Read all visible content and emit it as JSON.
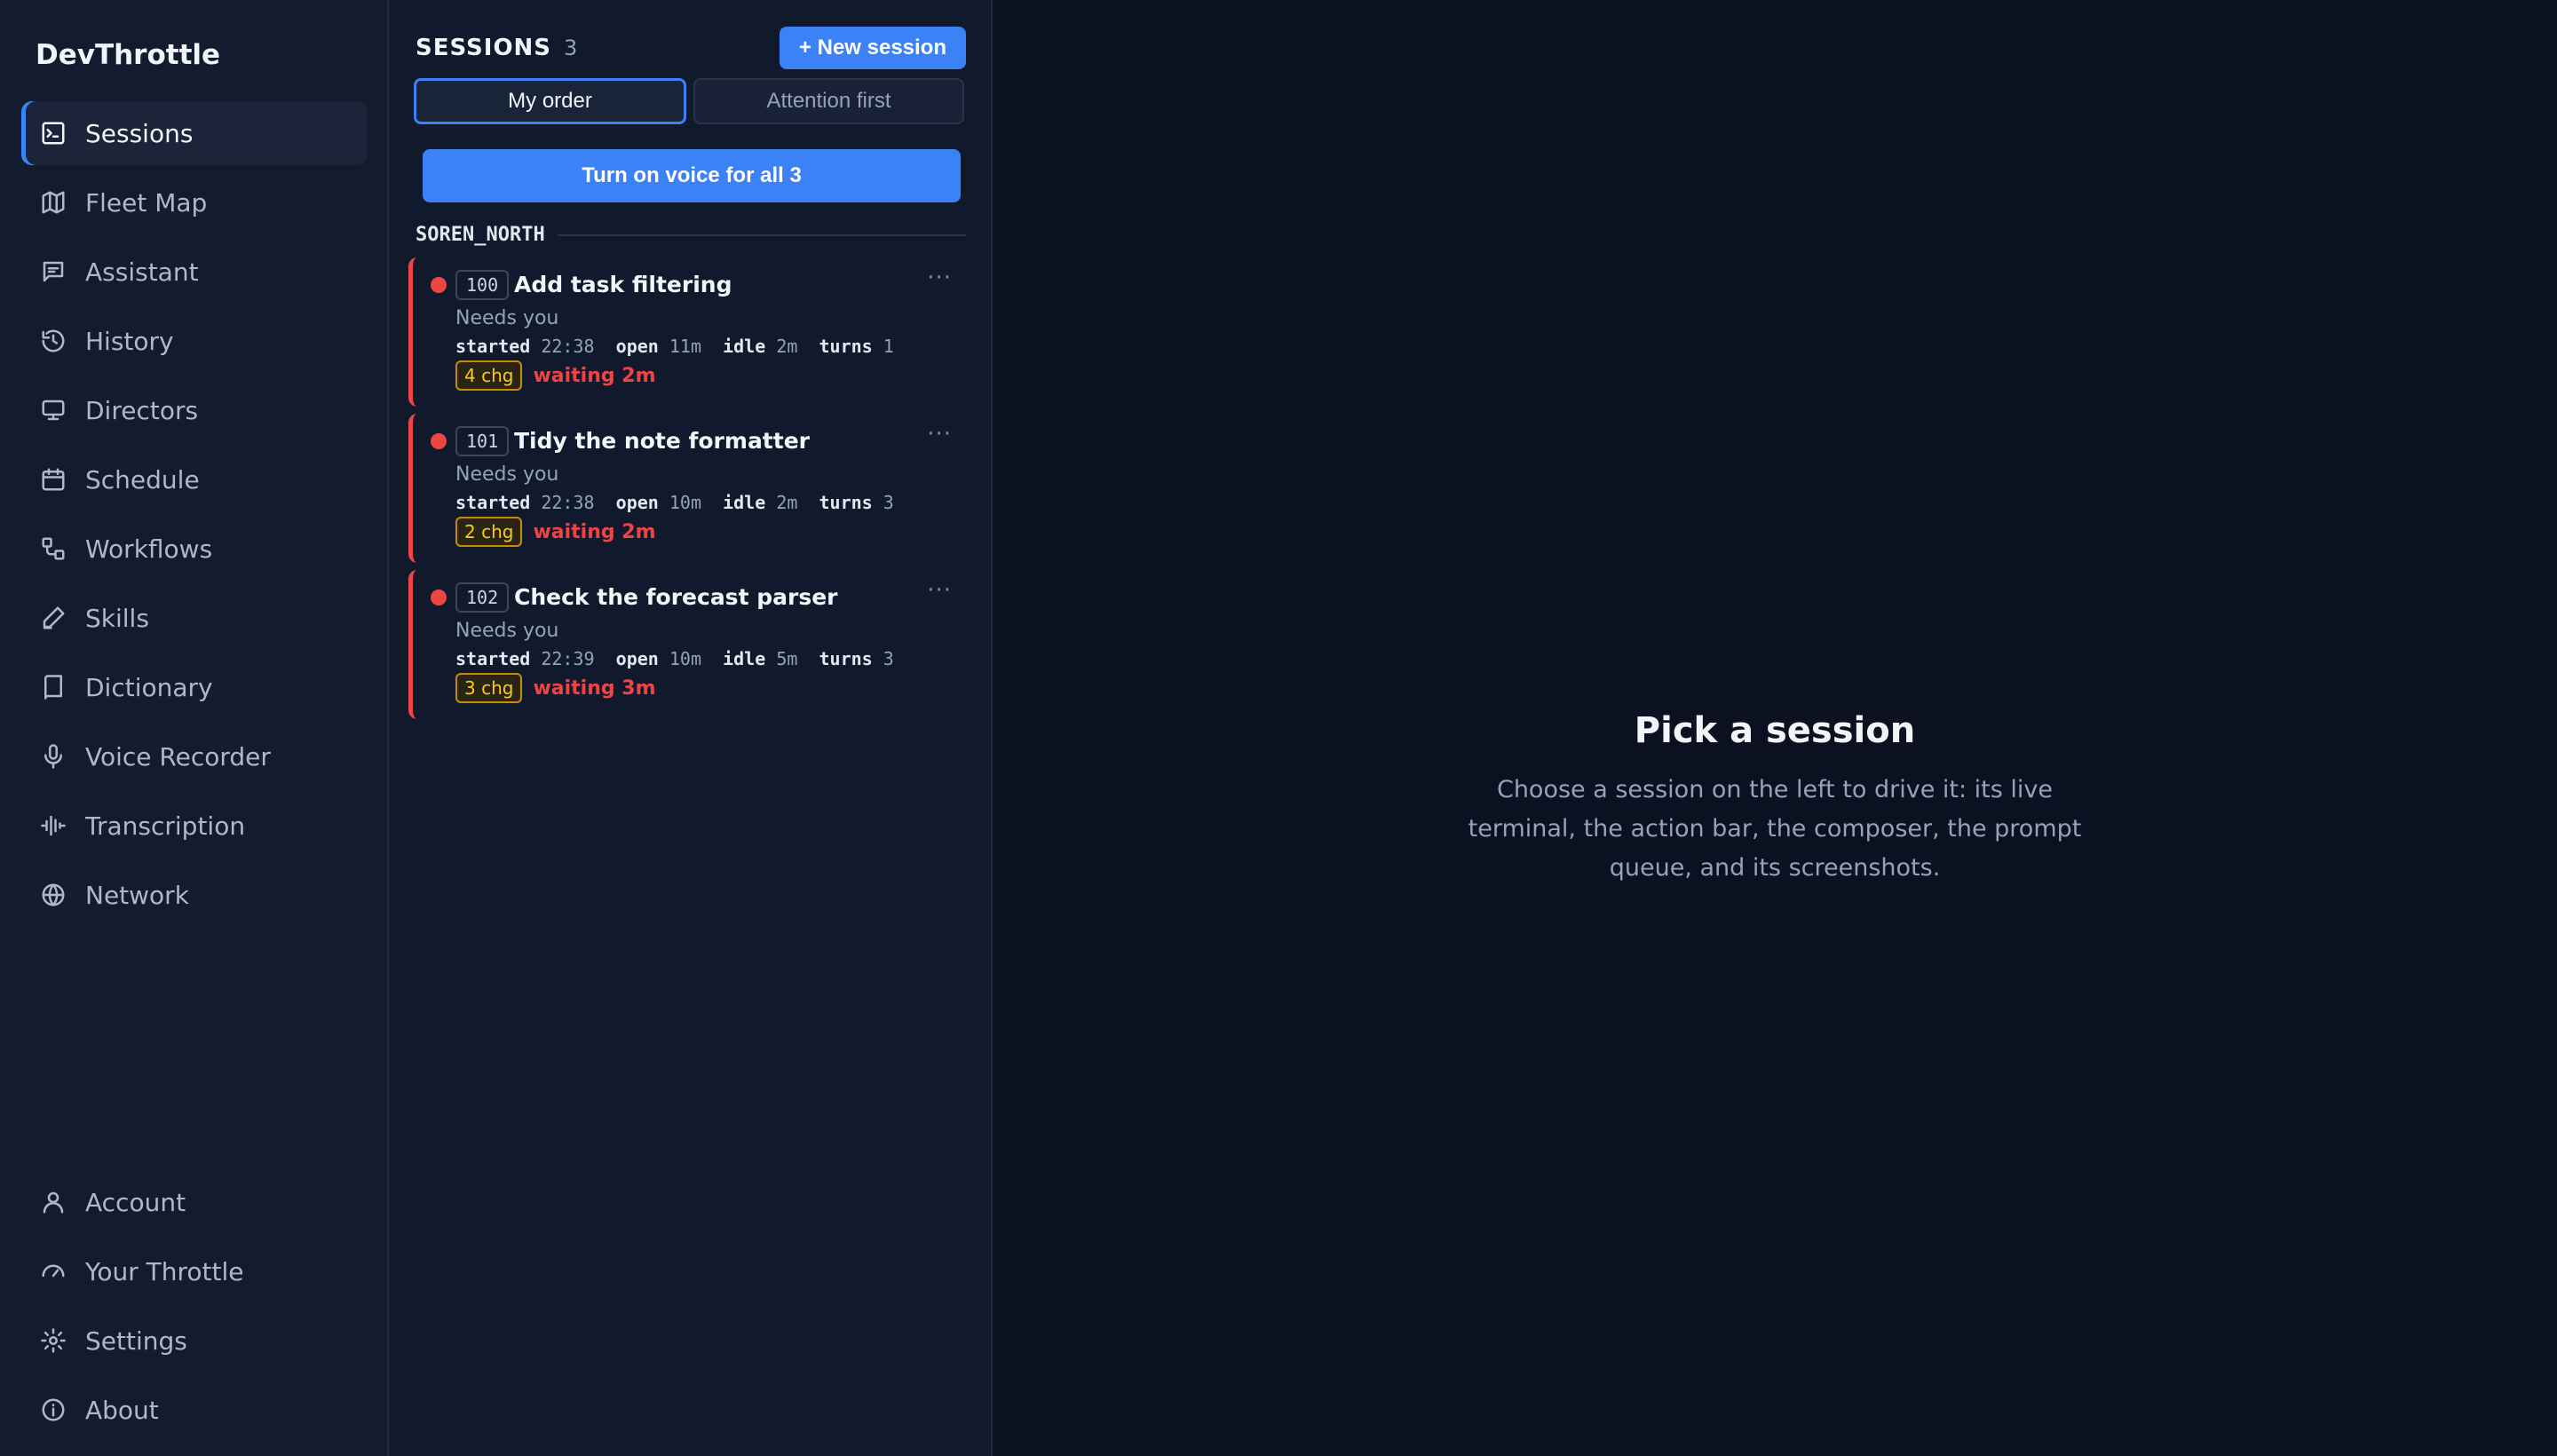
{
  "app": {
    "name": "DevThrottle"
  },
  "nav": {
    "items": [
      {
        "label": "Sessions",
        "icon": "terminal-icon",
        "active": true
      },
      {
        "label": "Fleet Map",
        "icon": "map-icon"
      },
      {
        "label": "Assistant",
        "icon": "chat-icon"
      },
      {
        "label": "History",
        "icon": "history-icon"
      },
      {
        "label": "Directors",
        "icon": "monitor-icon"
      },
      {
        "label": "Schedule",
        "icon": "calendar-icon"
      },
      {
        "label": "Workflows",
        "icon": "workflow-icon"
      },
      {
        "label": "Skills",
        "icon": "pen-icon"
      },
      {
        "label": "Dictionary",
        "icon": "book-icon"
      },
      {
        "label": "Voice Recorder",
        "icon": "microphone-icon"
      },
      {
        "label": "Transcription",
        "icon": "waveform-icon"
      },
      {
        "label": "Network",
        "icon": "globe-icon"
      }
    ],
    "bottom": [
      {
        "label": "Account",
        "icon": "user-icon"
      },
      {
        "label": "Your Throttle",
        "icon": "gauge-icon"
      },
      {
        "label": "Settings",
        "icon": "gear-icon"
      },
      {
        "label": "About",
        "icon": "info-icon"
      }
    ]
  },
  "sessions": {
    "title": "SESSIONS",
    "count": "3",
    "new_label": "+ New session",
    "toggle": {
      "left": "My order",
      "right": "Attention first",
      "active": "left"
    },
    "voice_label": "Turn on voice for all 3",
    "group": "SOREN_NORTH",
    "cards": [
      {
        "num": "100",
        "name": "Add task filtering",
        "status": "Needs you",
        "started": "22:38",
        "open": "11m",
        "idle": "2m",
        "turns": "1",
        "chg": "4 chg",
        "waiting": "waiting 2m"
      },
      {
        "num": "101",
        "name": "Tidy the note formatter",
        "status": "Needs you",
        "started": "22:38",
        "open": "10m",
        "idle": "2m",
        "turns": "3",
        "chg": "2 chg",
        "waiting": "waiting 2m"
      },
      {
        "num": "102",
        "name": "Check the forecast parser",
        "status": "Needs you",
        "started": "22:39",
        "open": "10m",
        "idle": "5m",
        "turns": "3",
        "chg": "3 chg",
        "waiting": "waiting 3m"
      }
    ],
    "meta_labels": {
      "started": "started",
      "open": "open",
      "idle": "idle",
      "turns": "turns"
    },
    "more_label": "···"
  },
  "main": {
    "title": "Pick a session",
    "description": "Choose a session on the left to drive it: its live terminal, the action bar, the composer, the prompt queue, and its screenshots."
  },
  "colors": {
    "accent": "#3b82f6",
    "attention": "#ef4444",
    "change": "#facc15"
  }
}
